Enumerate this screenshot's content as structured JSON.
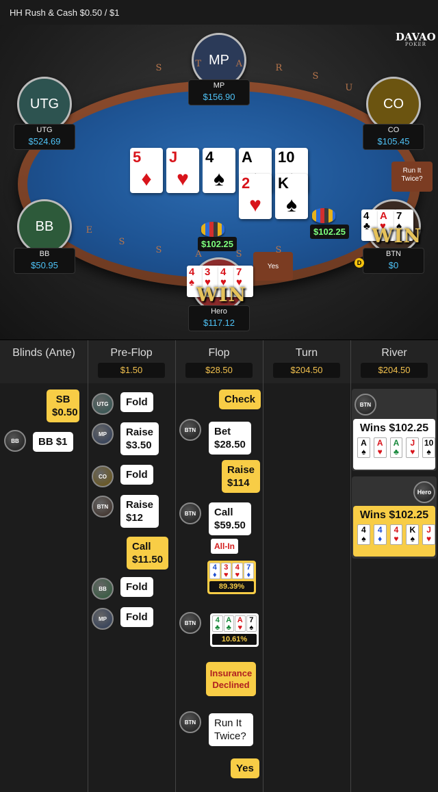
{
  "topbar": {
    "title": "HH  Rush & Cash $0.50 / $1"
  },
  "logo": {
    "main": "DAVAO",
    "sub": "POKER"
  },
  "rail_letters": [
    "S",
    "T",
    "A",
    "R",
    "S",
    "U",
    "S",
    "S",
    "A",
    "S",
    "S",
    "E"
  ],
  "seats": [
    {
      "id": "MP",
      "circle": "MP",
      "name": "MP",
      "stack": "$156.90",
      "color": "#2b3a58"
    },
    {
      "id": "UTG",
      "circle": "UTG",
      "name": "UTG",
      "stack": "$524.69",
      "color": "#2d5350"
    },
    {
      "id": "CO",
      "circle": "CO",
      "name": "CO",
      "stack": "$105.45",
      "color": "#6b5410"
    },
    {
      "id": "BB",
      "circle": "BB",
      "name": "BB",
      "stack": "$50.95",
      "color": "#2d5a3a"
    },
    {
      "id": "BTN",
      "circle": "",
      "name": "BTN",
      "stack": "$0",
      "color": "#3a2a22"
    },
    {
      "id": "Hero",
      "circle": "",
      "name": "Hero",
      "stack": "$117.12",
      "color": "#8b2b2b"
    }
  ],
  "board": {
    "run1": [
      {
        "rank": "5",
        "suit": "♦",
        "color": "red"
      },
      {
        "rank": "J",
        "suit": "♥",
        "color": "red"
      },
      {
        "rank": "4",
        "suit": "♠",
        "color": "black"
      },
      {
        "rank": "A",
        "suit": "♠",
        "color": "black"
      },
      {
        "rank": "10",
        "suit": "♠",
        "color": "black"
      }
    ],
    "run2": [
      {
        "rank": "2",
        "suit": "♥",
        "color": "red"
      },
      {
        "rank": "K",
        "suit": "♠",
        "color": "black"
      }
    ]
  },
  "pots": {
    "left": "$102.25",
    "right": "$102.25"
  },
  "run_it_twice_prompt": "Run It Twice?",
  "yes_label": "Yes",
  "btn_cards": [
    {
      "rank": "4",
      "suit": "♣",
      "color": "black"
    },
    {
      "rank": "A",
      "suit": "♥",
      "color": "red"
    },
    {
      "rank": "7",
      "suit": "♠",
      "color": "black"
    }
  ],
  "hero_cards": [
    {
      "rank": "4",
      "suit": "♠",
      "color": "red"
    },
    {
      "rank": "3",
      "suit": "♥",
      "color": "red"
    },
    {
      "rank": "4",
      "suit": "♥",
      "color": "red"
    },
    {
      "rank": "7",
      "suit": "♥",
      "color": "red"
    }
  ],
  "win_label": "WIN",
  "dealer_label": "D",
  "history": {
    "columns": [
      {
        "title": "Blinds (Ante)",
        "amount": ""
      },
      {
        "title": "Pre-Flop",
        "amount": "$1.50"
      },
      {
        "title": "Flop",
        "amount": "$28.50"
      },
      {
        "title": "Turn",
        "amount": "$204.50"
      },
      {
        "title": "River",
        "amount": "$204.50"
      }
    ],
    "blinds": {
      "sb_line1": "SB",
      "sb_line2": "$0.50",
      "bb_badge": "BB",
      "bb_text": "BB $1"
    },
    "preflop": [
      {
        "badge": "UTG",
        "line1": "Fold",
        "line2": ""
      },
      {
        "badge": "MP",
        "line1": "Raise",
        "line2": "$3.50"
      },
      {
        "badge": "CO",
        "line1": "Fold",
        "line2": ""
      },
      {
        "badge": "BTN",
        "line1": "Raise",
        "line2": "$12"
      },
      {
        "badge": "",
        "line1": "Call",
        "line2": "$11.50"
      },
      {
        "badge": "BB",
        "line1": "Fold",
        "line2": ""
      },
      {
        "badge": "MP",
        "line1": "Fold",
        "line2": ""
      }
    ],
    "flop": {
      "check": "Check",
      "btn_bet": {
        "badge": "BTN",
        "line1": "Bet",
        "line2": "$28.50"
      },
      "hero_raise": {
        "line1": "Raise",
        "line2": "$114"
      },
      "btn_call": {
        "badge": "BTN",
        "line1": "Call",
        "line2": "$59.50"
      },
      "allin": "All-In",
      "hero_equity": {
        "cards": [
          {
            "rank": "4",
            "suit": "♦",
            "color": "blue"
          },
          {
            "rank": "3",
            "suit": "♥",
            "color": "red"
          },
          {
            "rank": "4",
            "suit": "♥",
            "color": "red"
          },
          {
            "rank": "7",
            "suit": "♦",
            "color": "blue"
          }
        ],
        "pct": "89.39%"
      },
      "btn_equity": {
        "badge": "BTN",
        "cards": [
          {
            "rank": "4",
            "suit": "♣",
            "color": "green"
          },
          {
            "rank": "A",
            "suit": "♣",
            "color": "green"
          },
          {
            "rank": "A",
            "suit": "♥",
            "color": "red"
          },
          {
            "rank": "7",
            "suit": "♠",
            "color": "black"
          }
        ],
        "pct": "10.61%"
      },
      "insurance": {
        "line1": "Insurance",
        "line2": "Declined"
      },
      "rit": {
        "badge": "BTN",
        "line1": "Run It",
        "line2": "Twice?"
      },
      "yes": "Yes"
    },
    "river": {
      "btn": {
        "badge": "BTN",
        "title": "Wins $102.25",
        "cards": [
          {
            "rank": "A",
            "suit": "♠",
            "color": "black"
          },
          {
            "rank": "A",
            "suit": "♥",
            "color": "red"
          },
          {
            "rank": "A",
            "suit": "♣",
            "color": "green"
          },
          {
            "rank": "J",
            "suit": "♥",
            "color": "red"
          },
          {
            "rank": "10",
            "suit": "♠",
            "color": "black"
          }
        ]
      },
      "hero": {
        "badge": "Hero",
        "title": "Wins $102.25",
        "cards": [
          {
            "rank": "4",
            "suit": "♠",
            "color": "black"
          },
          {
            "rank": "4",
            "suit": "♦",
            "color": "blue"
          },
          {
            "rank": "4",
            "suit": "♥",
            "color": "red"
          },
          {
            "rank": "K",
            "suit": "♠",
            "color": "black"
          },
          {
            "rank": "J",
            "suit": "♥",
            "color": "red"
          }
        ]
      }
    }
  }
}
